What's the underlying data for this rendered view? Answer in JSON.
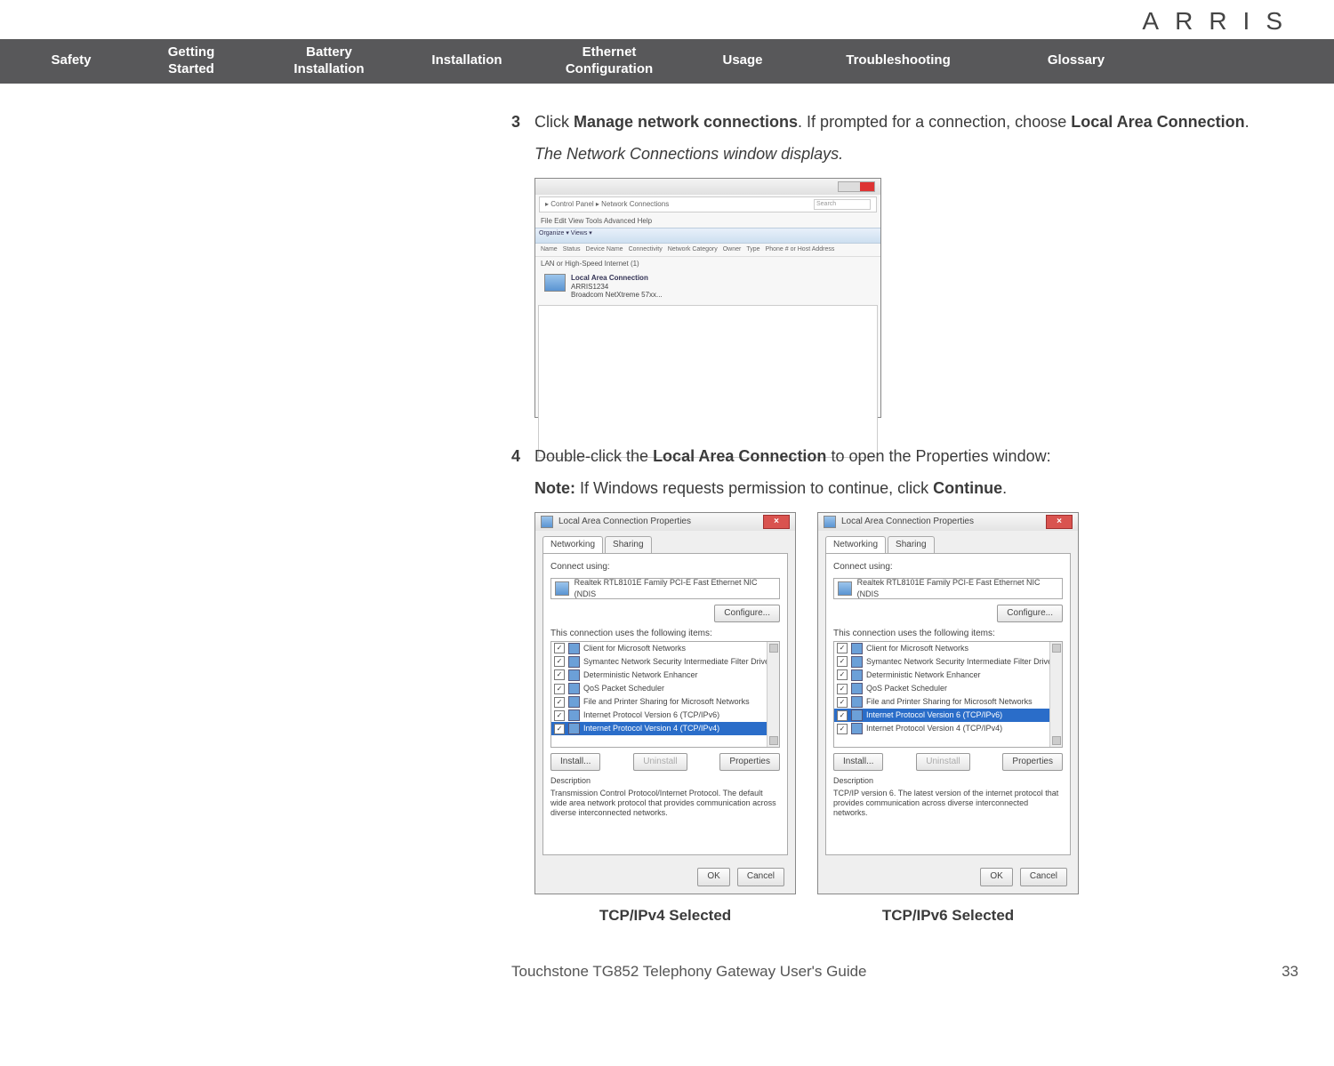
{
  "brand": "ARRIS",
  "nav": {
    "safety": "Safety",
    "getting1": "Getting",
    "getting2": "Started",
    "battery1": "Battery",
    "battery2": "Installation",
    "installation": "Installation",
    "ethernet1": "Ethernet",
    "ethernet2": "Configuration",
    "usage": "Usage",
    "troubleshooting": "Troubleshooting",
    "glossary": "Glossary"
  },
  "step3": {
    "num": "3",
    "pre": "Click ",
    "bold1": "Manage network connections",
    "mid": ". If prompted for a connection, choose ",
    "bold2": "Local Area Connection",
    "post": ".",
    "italic": "The Network Connections window displays."
  },
  "screenshot1": {
    "breadcrumb_left": "▸ Control Panel ▸ Network Connections",
    "search_placeholder": "Search",
    "menu": "File   Edit   View   Tools   Advanced   Help",
    "toolbar": "Organize ▾   Views ▾",
    "cols": [
      "Name",
      "Status",
      "Device Name",
      "Connectivity",
      "Network Category",
      "Owner",
      "Type",
      "Phone # or Host Address"
    ],
    "section": "LAN or High-Speed Internet (1)",
    "item_line1": "Local Area Connection",
    "item_line2": "ARRIS1234",
    "item_line3": "Broadcom NetXtreme 57xx..."
  },
  "step4": {
    "num": "4",
    "pre": "Double-click the ",
    "bold1": "Local Area Connection",
    "mid": " to open the Properties window:",
    "note_label": "Note:",
    "note_body_pre": " If Windows requests permission to continue, click ",
    "note_bold": "Continue",
    "note_post": "."
  },
  "propsCommon": {
    "title": "Local Area Connection Properties",
    "tab1": "Networking",
    "tab2": "Sharing",
    "connect_label": "Connect using:",
    "adapter": "Realtek RTL8101E Family PCI-E Fast Ethernet NIC (NDIS",
    "configure": "Configure...",
    "uses": "This connection uses the following items:",
    "install": "Install...",
    "uninstall": "Uninstall",
    "properties": "Properties",
    "desc_label": "Description",
    "ok": "OK",
    "cancel": "Cancel",
    "items": [
      "Client for Microsoft Networks",
      "Symantec Network Security Intermediate Filter Driver",
      "Deterministic Network Enhancer",
      "QoS Packet Scheduler",
      "File and Printer Sharing for Microsoft Networks",
      "Internet Protocol Version 6 (TCP/IPv6)",
      "Internet Protocol Version 4 (TCP/IPv4)"
    ]
  },
  "propsLeft": {
    "selected_index": 6,
    "desc": "Transmission Control Protocol/Internet Protocol. The default wide area network protocol that provides communication across diverse interconnected networks."
  },
  "propsRight": {
    "selected_index": 5,
    "desc": "TCP/IP version 6. The latest version of the internet protocol that provides communication across diverse interconnected networks."
  },
  "captions": {
    "left": "TCP/IPv4 Selected",
    "right": "TCP/IPv6 Selected"
  },
  "footer": {
    "title": "Touchstone TG852 Telephony Gateway User's Guide",
    "page": "33"
  }
}
